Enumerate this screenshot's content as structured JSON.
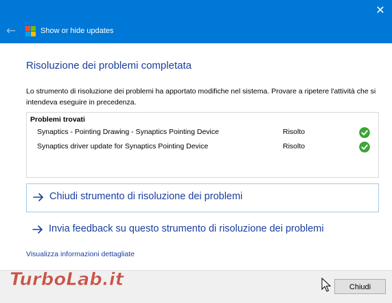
{
  "window": {
    "close_glyph": "✕"
  },
  "header": {
    "back_glyph": "←",
    "title": "Show or hide updates",
    "logo_colors": [
      "#f25022",
      "#7fba00",
      "#00a4ef",
      "#ffb900"
    ]
  },
  "main": {
    "heading": "Risoluzione dei problemi completata",
    "description": "Lo strumento di risoluzione dei problemi ha apportato modifiche nel sistema. Provare a ripetere l'attività che si intendeva eseguire in precedenza."
  },
  "problems": {
    "title": "Problemi trovati",
    "rows": [
      {
        "name": "Synaptics - Pointing Drawing - Synaptics Pointing Device",
        "status": "Risolto",
        "status_icon": "check-icon"
      },
      {
        "name": "Synaptics driver update for Synaptics Pointing Device",
        "status": "Risolto",
        "status_icon": "check-icon"
      }
    ]
  },
  "actions": {
    "close_troubleshooter": "Chiudi strumento di risoluzione dei problemi",
    "send_feedback": "Invia feedback su questo strumento di risoluzione dei problemi"
  },
  "details_link": "Visualizza informazioni dettagliate",
  "footer": {
    "close_button": "Chiudi"
  },
  "watermark": {
    "text": "TurboLab.it"
  },
  "colors": {
    "title_bar": "#0078d7",
    "link_blue": "#1a3e9f",
    "check_green": "#3aa935",
    "watermark_red": "#c0392b"
  }
}
